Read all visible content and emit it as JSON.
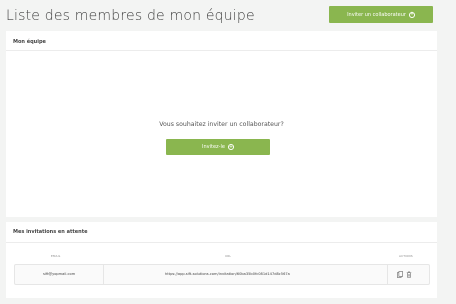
{
  "page": {
    "title": "Liste des membres de mon équipe"
  },
  "header": {
    "invite_button_label": "Inviter un collaborateur"
  },
  "team_card": {
    "title": "Mon équipe",
    "question": "Vous souhaitez inviter un collaborateur?",
    "invite_button_label": "Invitez-le"
  },
  "pending_card": {
    "title": "Mes invitations en attente",
    "columns": {
      "email": "EMAIL",
      "url": "URL",
      "actions": "ACTIONS"
    },
    "rows": [
      {
        "email": "sift@yopmail.com",
        "url": "https://app.sift-solutions.com/invitation/60ba35b0fc081d147d8c567a"
      }
    ]
  },
  "icons": {
    "plus": "plus-circle-icon",
    "copy": "copy-icon",
    "delete": "trash-icon"
  },
  "colors": {
    "accent": "#8ab64f",
    "background": "#f3f4f3"
  }
}
